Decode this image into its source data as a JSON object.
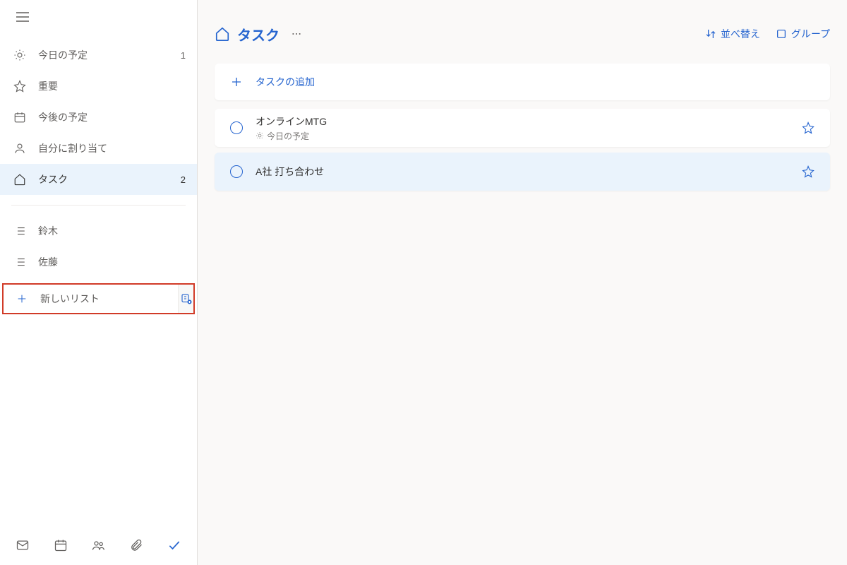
{
  "sidebar": {
    "nav": [
      {
        "icon": "sun",
        "label": "今日の予定",
        "count": "1",
        "id": "today"
      },
      {
        "icon": "star",
        "label": "重要",
        "count": "",
        "id": "important"
      },
      {
        "icon": "calendar",
        "label": "今後の予定",
        "count": "",
        "id": "planned"
      },
      {
        "icon": "person",
        "label": "自分に割り当て",
        "count": "",
        "id": "assigned"
      },
      {
        "icon": "home",
        "label": "タスク",
        "count": "2",
        "id": "tasks"
      }
    ],
    "custom_lists": [
      {
        "label": "鈴木",
        "id": "suzuki"
      },
      {
        "label": "佐藤",
        "id": "sato"
      }
    ],
    "new_list_placeholder": "新しいリスト",
    "bottom_icons": [
      "mail",
      "calendar",
      "people",
      "attach",
      "check"
    ]
  },
  "header": {
    "title": "タスク",
    "sort_label": "並べ替え",
    "group_label": "グループ"
  },
  "add_task_label": "タスクの追加",
  "tasks": [
    {
      "title": "オンラインMTG",
      "meta": "今日の予定",
      "meta_icon": "sun",
      "selected": false
    },
    {
      "title": "A社 打ち合わせ",
      "meta": "",
      "meta_icon": "",
      "selected": true
    }
  ],
  "colors": {
    "accent": "#2564cf",
    "highlight_border": "#d13b28"
  }
}
